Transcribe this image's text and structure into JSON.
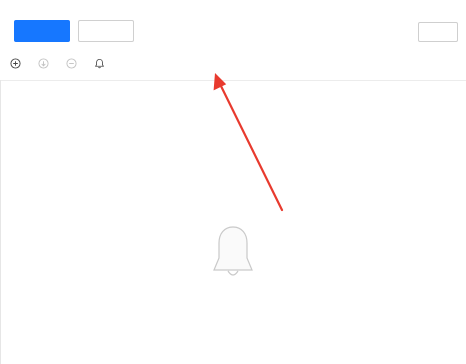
{
  "tabs": [
    {
      "label": "",
      "active": true
    },
    {
      "label": "",
      "active": false
    }
  ],
  "search_button": {
    "label": ""
  },
  "toolbar": {
    "add": {
      "label": "",
      "icon": "plus-circle-icon"
    },
    "import": {
      "label": "",
      "icon": "import-icon",
      "disabled": true
    },
    "delete": {
      "label": "",
      "icon": "delete-icon",
      "disabled": true
    },
    "ringtone": {
      "label": "",
      "icon": "bell-icon"
    }
  },
  "empty_state": {
    "title": "",
    "hint": "",
    "icon": "bell-icon"
  },
  "annotation": {
    "icon": "arrow-icon",
    "color": "#e83a2e"
  },
  "colors": {
    "accent": "#1677ff",
    "annotation": "#e83a2e"
  }
}
